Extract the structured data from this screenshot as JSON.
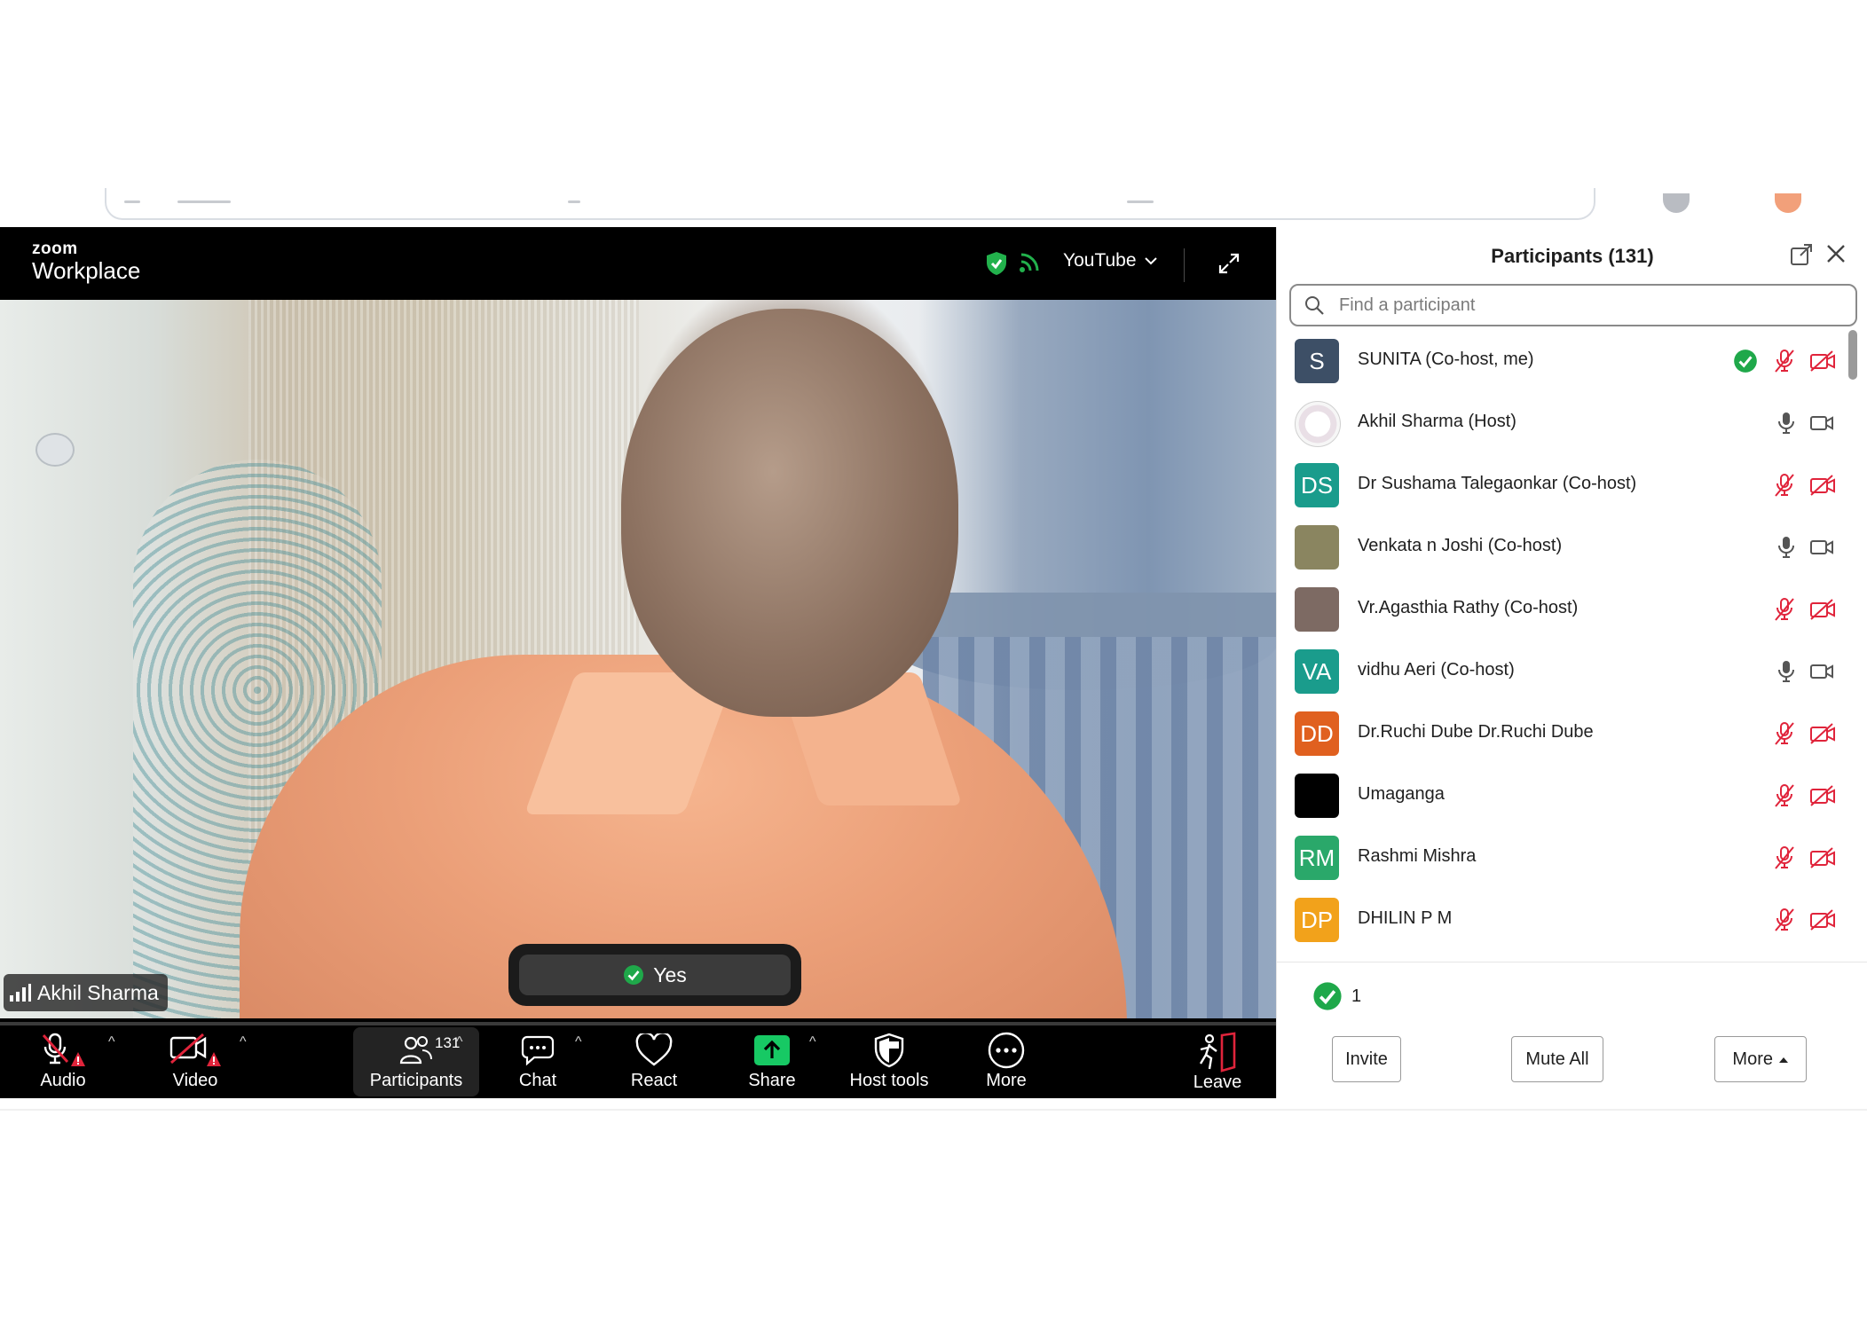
{
  "meeting": {
    "brand_small": "zoom",
    "brand_big": "Workplace",
    "youtube_label": "YouTube",
    "speaker_name": "Akhil Sharma",
    "reaction_label": "Yes"
  },
  "toolbar": {
    "audio": "Audio",
    "video": "Video",
    "participants": "Participants",
    "participants_count": "131",
    "chat": "Chat",
    "react": "React",
    "share": "Share",
    "host_tools": "Host tools",
    "more": "More",
    "leave": "Leave"
  },
  "panel": {
    "title": "Participants (131)",
    "search_placeholder": "Find a participant",
    "participants": [
      {
        "initials": "S",
        "name": "SUNITA (Co-host, me)",
        "avatar_color": "#3d4f66",
        "mic": "muted",
        "cam": "off",
        "yes": true
      },
      {
        "initials": "",
        "name": "Akhil Sharma (Host)",
        "avatar_color": "#f0f0f0",
        "mic": "on",
        "cam": "on",
        "yes": false
      },
      {
        "initials": "DS",
        "name": "Dr Sushama Talegaonkar (Co-host)",
        "avatar_color": "#1a9c8c",
        "mic": "muted",
        "cam": "off",
        "yes": false
      },
      {
        "initials": "",
        "name": "Venkata n Joshi (Co-host)",
        "avatar_color": "#8a8560",
        "mic": "on",
        "cam": "on",
        "yes": false
      },
      {
        "initials": "",
        "name": "Vr.Agasthia Rathy (Co-host)",
        "avatar_color": "#7d6a63",
        "mic": "muted",
        "cam": "off",
        "yes": false
      },
      {
        "initials": "VA",
        "name": "vidhu Aeri (Co-host)",
        "avatar_color": "#1a9c8c",
        "mic": "on",
        "cam": "on",
        "yes": false
      },
      {
        "initials": "DD",
        "name": "Dr.Ruchi Dube Dr.Ruchi Dube",
        "avatar_color": "#e0601f",
        "mic": "muted",
        "cam": "off",
        "yes": false
      },
      {
        "initials": "",
        "name": "Umaganga",
        "avatar_color": "#000000",
        "mic": "muted",
        "cam": "off",
        "yes": false
      },
      {
        "initials": "RM",
        "name": "Rashmi Mishra",
        "avatar_color": "#2aa86a",
        "mic": "muted",
        "cam": "off",
        "yes": false
      },
      {
        "initials": "DP",
        "name": "DHILIN P M",
        "avatar_color": "#f2a21b",
        "mic": "muted",
        "cam": "off",
        "yes": false
      }
    ],
    "yes_count": "1",
    "invite": "Invite",
    "mute_all": "Mute All",
    "more": "More"
  },
  "colors": {
    "muted_red": "#e0243b",
    "check_green": "#1fa84a",
    "share_green": "#17c964"
  }
}
